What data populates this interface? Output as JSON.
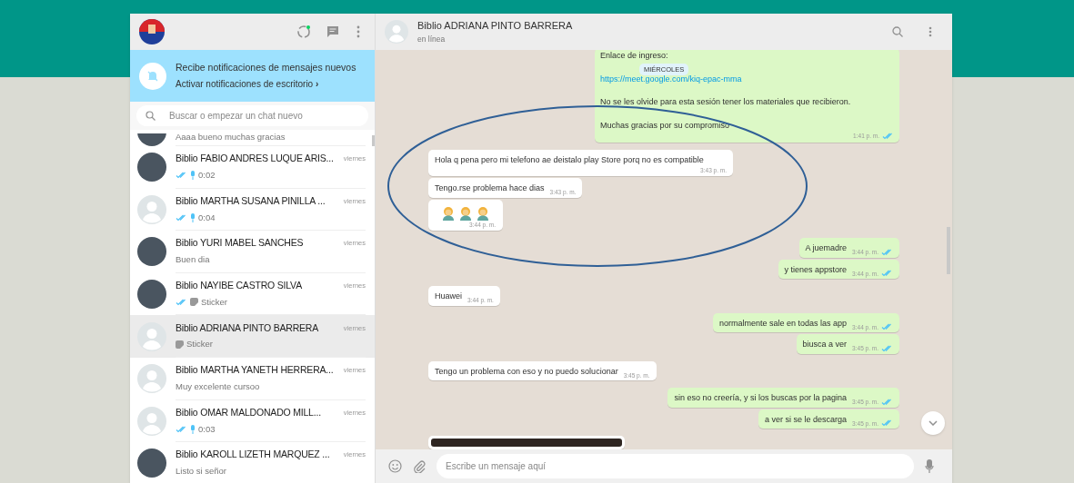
{
  "sidebar": {
    "banner": {
      "title": "Recibe notificaciones de mensajes nuevos",
      "link": "Activar notificaciones de escritorio",
      "chevron": "›"
    },
    "search": {
      "placeholder": "Buscar o empezar un chat nuevo"
    },
    "chats": [
      {
        "preview": {
          "kind": "text",
          "text": "Aaaa bueno muchas gracias"
        },
        "read": false,
        "photo": true,
        "selected": false,
        "partial": true
      },
      {
        "name": "Biblio FABIO ANDRES LUQUE ARIS...",
        "time": "viernes",
        "preview": {
          "kind": "voice",
          "text": "0:02"
        },
        "read": true,
        "photo": true,
        "selected": false,
        "partial": false
      },
      {
        "name": "Biblio MARTHA SUSANA PINILLA ...",
        "time": "viernes",
        "preview": {
          "kind": "voice",
          "text": "0:04"
        },
        "read": true,
        "photo": false,
        "selected": false,
        "partial": false
      },
      {
        "name": "Biblio YURI MABEL SANCHES",
        "time": "viernes",
        "preview": {
          "kind": "text",
          "text": "Buen dia"
        },
        "read": false,
        "photo": true,
        "selected": false,
        "partial": false
      },
      {
        "name": "Biblio NAYIBE CASTRO SILVA",
        "time": "viernes",
        "preview": {
          "kind": "sticker",
          "text": "Sticker"
        },
        "read": true,
        "photo": true,
        "selected": false,
        "partial": false
      },
      {
        "name": "Biblio ADRIANA PINTO BARRERA",
        "time": "viernes",
        "preview": {
          "kind": "sticker",
          "text": "Sticker"
        },
        "read": false,
        "photo": false,
        "selected": true,
        "partial": false
      },
      {
        "name": "Biblio MARTHA YANETH HERRERA...",
        "time": "viernes",
        "preview": {
          "kind": "text",
          "text": "Muy excelente cursoo"
        },
        "read": false,
        "photo": false,
        "selected": false,
        "partial": false
      },
      {
        "name": "Biblio OMAR MALDONADO MILL...",
        "time": "viernes",
        "preview": {
          "kind": "voice",
          "text": "0:03"
        },
        "read": true,
        "photo": false,
        "selected": false,
        "partial": false
      },
      {
        "name": "Biblio KAROLL LIZETH MARQUEZ ...",
        "time": "viernes",
        "preview": {
          "kind": "text",
          "text": "Listo si señor"
        },
        "read": false,
        "photo": true,
        "selected": false,
        "partial": false
      }
    ]
  },
  "conversation": {
    "title": "Biblio ADRIANA PINTO BARRERA",
    "status": "en línea",
    "date_badge": "MIÉRCOLES",
    "messages": [
      {
        "kind": "text",
        "outgoing": true,
        "lines": [
          {
            "text": "Enlace de ingreso:",
            "link": false
          },
          {
            "text": "https://meet.google.com/kiq-epac-mma",
            "link": true
          },
          {
            "text": "No se les olvide para esta sesión tener los materiales que recibieron.",
            "link": false
          },
          {
            "text": "Muchas gracias por su compromiso",
            "link": false
          }
        ],
        "time": "1:41 p. m.",
        "read": true
      },
      {
        "kind": "text",
        "outgoing": false,
        "lines": [
          {
            "text": "Hola q pena pero mi telefono ae deistalo play Store porq no es compatible",
            "link": false
          }
        ],
        "time": "3:43 p. m."
      },
      {
        "kind": "text",
        "outgoing": false,
        "lines": [
          {
            "text": "Tengo.rse problema hace dias",
            "link": false
          }
        ],
        "time": "3:43 p. m."
      },
      {
        "kind": "emoji",
        "outgoing": false,
        "emojis": [
          {
            "kind": "person"
          },
          {
            "kind": "person"
          },
          {
            "kind": "person"
          }
        ],
        "time": "3:44 p. m."
      },
      {
        "kind": "text",
        "outgoing": true,
        "lines": [
          {
            "text": "A juemadre",
            "link": false
          }
        ],
        "time": "3:44 p. m.",
        "read": true
      },
      {
        "kind": "text",
        "outgoing": true,
        "lines": [
          {
            "text": "y tienes appstore",
            "link": false
          }
        ],
        "time": "3:44 p. m.",
        "read": true
      },
      {
        "kind": "text",
        "outgoing": false,
        "lines": [
          {
            "text": "Huawei",
            "link": false
          }
        ],
        "time": "3:44 p. m."
      },
      {
        "kind": "text",
        "outgoing": true,
        "lines": [
          {
            "text": "normalmente sale en todas las app",
            "link": false
          }
        ],
        "time": "3:44 p. m.",
        "read": true
      },
      {
        "kind": "text",
        "outgoing": true,
        "lines": [
          {
            "text": "biusca a ver",
            "link": false
          }
        ],
        "time": "3:45 p. m.",
        "read": true
      },
      {
        "kind": "text",
        "outgoing": false,
        "lines": [
          {
            "text": "Tengo un problema con eso y no puedo solucionar",
            "link": false
          }
        ],
        "time": "3:45 p. m."
      },
      {
        "kind": "text",
        "outgoing": true,
        "lines": [
          {
            "text": "sin eso no creería, y si los buscas por la pagina",
            "link": false
          }
        ],
        "time": "3:45 p. m.",
        "read": true
      },
      {
        "kind": "text",
        "outgoing": true,
        "lines": [
          {
            "text": "a ver si se le descarga",
            "link": false
          }
        ],
        "time": "3:45 p. m.",
        "read": true
      },
      {
        "kind": "image",
        "outgoing": false
      }
    ],
    "composer": {
      "placeholder": "Escribe un mensaje aquí"
    }
  }
}
